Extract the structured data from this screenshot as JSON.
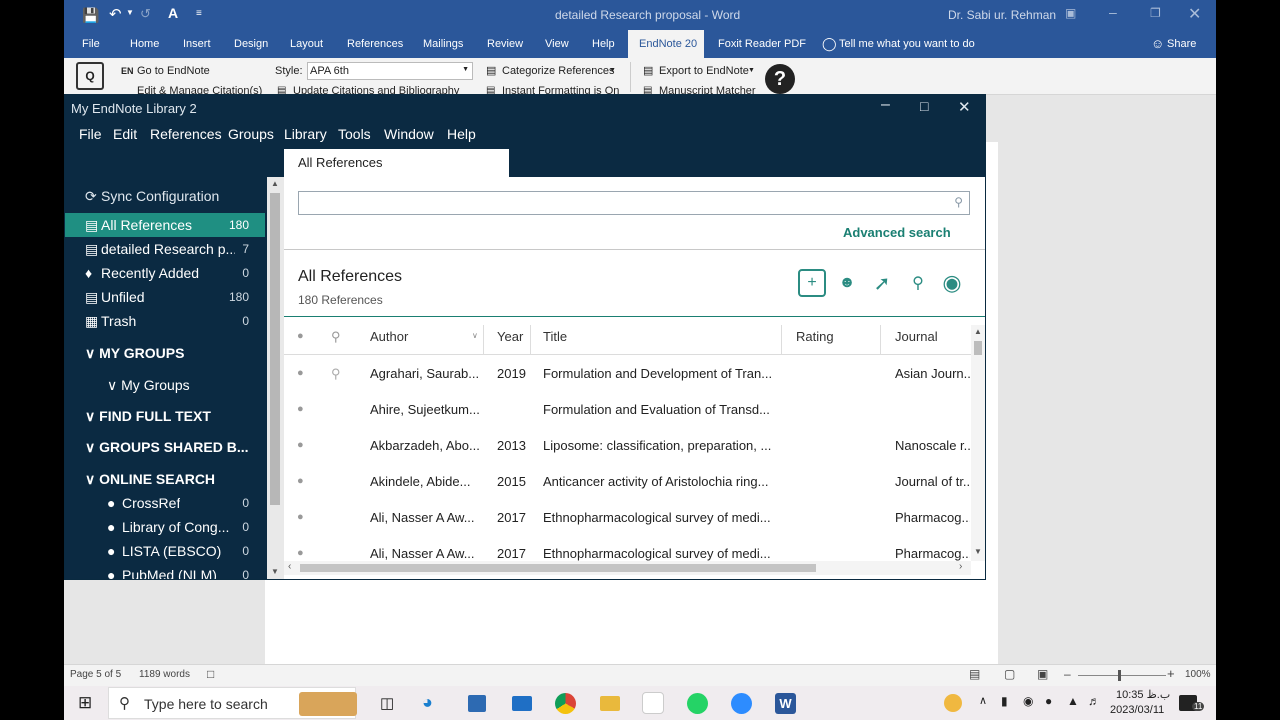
{
  "word": {
    "title": "detailed Research proposal - Word",
    "user": "Dr. Sabi ur. Rehman",
    "tabs": [
      "File",
      "Home",
      "Insert",
      "Design",
      "Layout",
      "References",
      "Mailings",
      "Review",
      "View",
      "Help",
      "EndNote 20",
      "Foxit Reader PDF"
    ],
    "tell_me": "Tell me what you want to do",
    "share": "Share",
    "ribbon": {
      "go_to_endnote": "Go to EndNote",
      "edit_manage": "Edit & Manage Citation(s)",
      "style_label": "Style:",
      "style_value": "APA 6th",
      "update_citations": "Update Citations and Bibliography",
      "categorize": "Categorize References",
      "instant_formatting": "Instant Formatting is On",
      "export": "Export to EndNote",
      "manuscript": "Manuscript Matcher"
    },
    "status": {
      "page": "Page 5 of 5",
      "words": "1189 words",
      "zoom": "100%"
    }
  },
  "endnote": {
    "title": "My EndNote Library 2",
    "menu": [
      "File",
      "Edit",
      "References",
      "Groups",
      "Library",
      "Tools",
      "Window",
      "Help"
    ],
    "tab": "All References",
    "sync": "Sync Configuration",
    "groups": [
      {
        "label": "All References",
        "count": "180"
      },
      {
        "label": "detailed Research p...",
        "count": "7"
      },
      {
        "label": "Recently Added",
        "count": "0"
      },
      {
        "label": "Unfiled",
        "count": "180"
      },
      {
        "label": "Trash",
        "count": "0"
      }
    ],
    "my_groups_head": "MY GROUPS",
    "my_groups_item": "My Groups",
    "find_full_text": "FIND FULL TEXT",
    "groups_shared": "GROUPS SHARED B...",
    "online_search": "ONLINE SEARCH",
    "online": [
      {
        "label": "CrossRef",
        "count": "0"
      },
      {
        "label": "Library of Cong...",
        "count": "0"
      },
      {
        "label": "LISTA (EBSCO)",
        "count": "0"
      },
      {
        "label": "PubMed (NLM)",
        "count": "0"
      }
    ],
    "search_placeholder": "",
    "advanced_search": "Advanced search",
    "list_title": "All References",
    "list_count": "180 References",
    "columns": [
      "Author",
      "Year",
      "Title",
      "Rating",
      "Journal"
    ],
    "rows": [
      {
        "author": "Agrahari, Saurab...",
        "year": "2019",
        "title": "Formulation and Development of Tran...",
        "journal": "Asian Journ...",
        "attach": true
      },
      {
        "author": "Ahire, Sujeetkum...",
        "year": "",
        "title": "Formulation and Evaluation of Transd...",
        "journal": "",
        "attach": false
      },
      {
        "author": "Akbarzadeh, Abo...",
        "year": "2013",
        "title": "Liposome: classification, preparation, ...",
        "journal": "Nanoscale r...",
        "attach": false
      },
      {
        "author": "Akindele, Abide...",
        "year": "2015",
        "title": "Anticancer activity of Aristolochia ring...",
        "journal": "Journal of tr...",
        "attach": false
      },
      {
        "author": "Ali, Nasser A Aw...",
        "year": "2017",
        "title": "Ethnopharmacological survey of medi...",
        "journal": "Pharmacog...",
        "attach": false
      },
      {
        "author": "Ali, Nasser A Aw...",
        "year": "2017",
        "title": "Ethnopharmacological survey of medi...",
        "journal": "Pharmacog...",
        "attach": false
      }
    ]
  },
  "taskbar": {
    "search_placeholder": "Type here to search",
    "time": "10:35 ب.ظ",
    "date": "2023/03/11",
    "notif_count": "11"
  },
  "colors": {
    "word_blue": "#2b579a",
    "endnote_navy": "#0b2a42",
    "endnote_teal": "#1a8a7d",
    "selected_group": "#1f8f82"
  }
}
